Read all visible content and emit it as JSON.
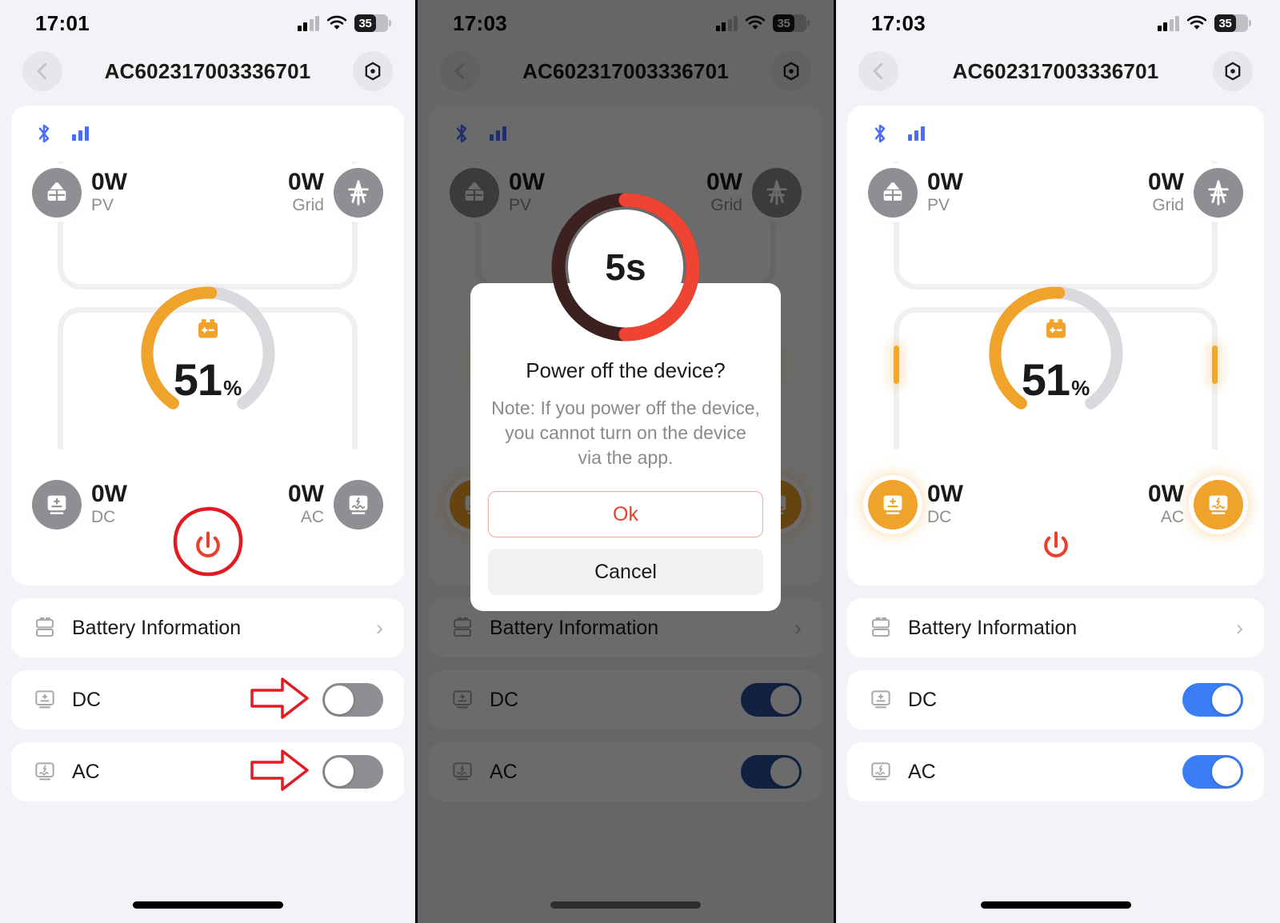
{
  "screens": [
    {
      "id": "screen-outputs-off",
      "status": {
        "time": "17:01",
        "battery_level": "35"
      },
      "nav": {
        "title": "AC602317003336701",
        "back_icon": "chevron-left-icon",
        "settings_icon": "hex-nut-icon"
      },
      "card": {
        "bluetooth_icon": "bluetooth-icon",
        "signal_icon": "signal-bars-icon",
        "nodes": {
          "pv": {
            "value": "0W",
            "label": "PV",
            "icon": "solar-panel-icon",
            "active": false
          },
          "grid": {
            "value": "0W",
            "label": "Grid",
            "icon": "power-tower-icon",
            "active": false
          },
          "dc": {
            "value": "0W",
            "label": "DC",
            "icon": "dc-output-icon",
            "active": false
          },
          "ac": {
            "value": "0W",
            "label": "AC",
            "icon": "ac-output-icon",
            "active": false
          }
        },
        "battery": {
          "percent": "51",
          "unit": "%",
          "value": 51,
          "icon": "battery-cell-icon"
        },
        "power_button_icon": "power-icon",
        "flow_active": false,
        "annotation": "red-circle-highlight"
      },
      "rows": [
        {
          "label": "Battery Information",
          "icon": "battery-info-icon",
          "type": "link",
          "chevron": "›"
        },
        {
          "label": "DC",
          "icon": "dc-output-icon",
          "type": "toggle",
          "on": false,
          "annotation": "red-arrow-right"
        },
        {
          "label": "AC",
          "icon": "ac-output-icon",
          "type": "toggle",
          "on": false,
          "annotation": "red-arrow-right"
        }
      ],
      "dialog": null
    },
    {
      "id": "screen-power-off-confirm",
      "status": {
        "time": "17:03",
        "battery_level": "35"
      },
      "nav": {
        "title": "AC602317003336701",
        "back_icon": "chevron-left-icon",
        "settings_icon": "hex-nut-icon"
      },
      "card": {
        "bluetooth_icon": "bluetooth-icon",
        "signal_icon": "signal-bars-icon",
        "nodes": {
          "pv": {
            "value": "0W",
            "label": "PV",
            "icon": "solar-panel-icon",
            "active": false
          },
          "grid": {
            "value": "0W",
            "label": "Grid",
            "icon": "power-tower-icon",
            "active": false
          },
          "dc": {
            "value": "0W",
            "label": "DC",
            "icon": "dc-output-icon",
            "active": true
          },
          "ac": {
            "value": "0W",
            "label": "AC",
            "icon": "ac-output-icon",
            "active": true
          }
        },
        "battery": {
          "percent": "51",
          "unit": "%",
          "value": 51,
          "icon": "battery-cell-icon"
        },
        "power_button_icon": "power-icon",
        "flow_active": true,
        "annotation": null
      },
      "rows": [
        {
          "label": "Battery Information",
          "icon": "battery-info-icon",
          "type": "link",
          "chevron": "›"
        },
        {
          "label": "DC",
          "icon": "dc-output-icon",
          "type": "toggle",
          "on": true,
          "annotation": null
        },
        {
          "label": "AC",
          "icon": "ac-output-icon",
          "type": "toggle",
          "on": true,
          "annotation": null
        }
      ],
      "dialog": {
        "countdown": "5s",
        "countdown_progress": 0.5,
        "title": "Power off the device?",
        "note": "Note: If you power off the device, you cannot turn on the device via the app.",
        "confirm_label": "Ok",
        "cancel_label": "Cancel"
      }
    },
    {
      "id": "screen-outputs-on",
      "status": {
        "time": "17:03",
        "battery_level": "35"
      },
      "nav": {
        "title": "AC602317003336701",
        "back_icon": "chevron-left-icon",
        "settings_icon": "hex-nut-icon"
      },
      "card": {
        "bluetooth_icon": "bluetooth-icon",
        "signal_icon": "signal-bars-icon",
        "nodes": {
          "pv": {
            "value": "0W",
            "label": "PV",
            "icon": "solar-panel-icon",
            "active": false
          },
          "grid": {
            "value": "0W",
            "label": "Grid",
            "icon": "power-tower-icon",
            "active": false
          },
          "dc": {
            "value": "0W",
            "label": "DC",
            "icon": "dc-output-icon",
            "active": true
          },
          "ac": {
            "value": "0W",
            "label": "AC",
            "icon": "ac-output-icon",
            "active": true
          }
        },
        "battery": {
          "percent": "51",
          "unit": "%",
          "value": 51,
          "icon": "battery-cell-icon"
        },
        "power_button_icon": "power-icon",
        "flow_active": true,
        "annotation": null
      },
      "rows": [
        {
          "label": "Battery Information",
          "icon": "battery-info-icon",
          "type": "link",
          "chevron": "›"
        },
        {
          "label": "DC",
          "icon": "dc-output-icon",
          "type": "toggle",
          "on": true,
          "annotation": null
        },
        {
          "label": "AC",
          "icon": "ac-output-icon",
          "type": "toggle",
          "on": true,
          "annotation": null
        }
      ],
      "dialog": null
    }
  ],
  "colors": {
    "accent_orange": "#f0a32a",
    "toggle_on_blue": "#3b7df7",
    "toggle_off_gray": "#8e8e93",
    "danger_red": "#e8402c",
    "countdown_red": "#ef4433",
    "countdown_track": "#3d2020",
    "annotation_red": "#e01b22",
    "bluetooth_blue": "#4a6cf7",
    "page_bg": "#f2f2f7",
    "card_bg": "#ffffff"
  }
}
